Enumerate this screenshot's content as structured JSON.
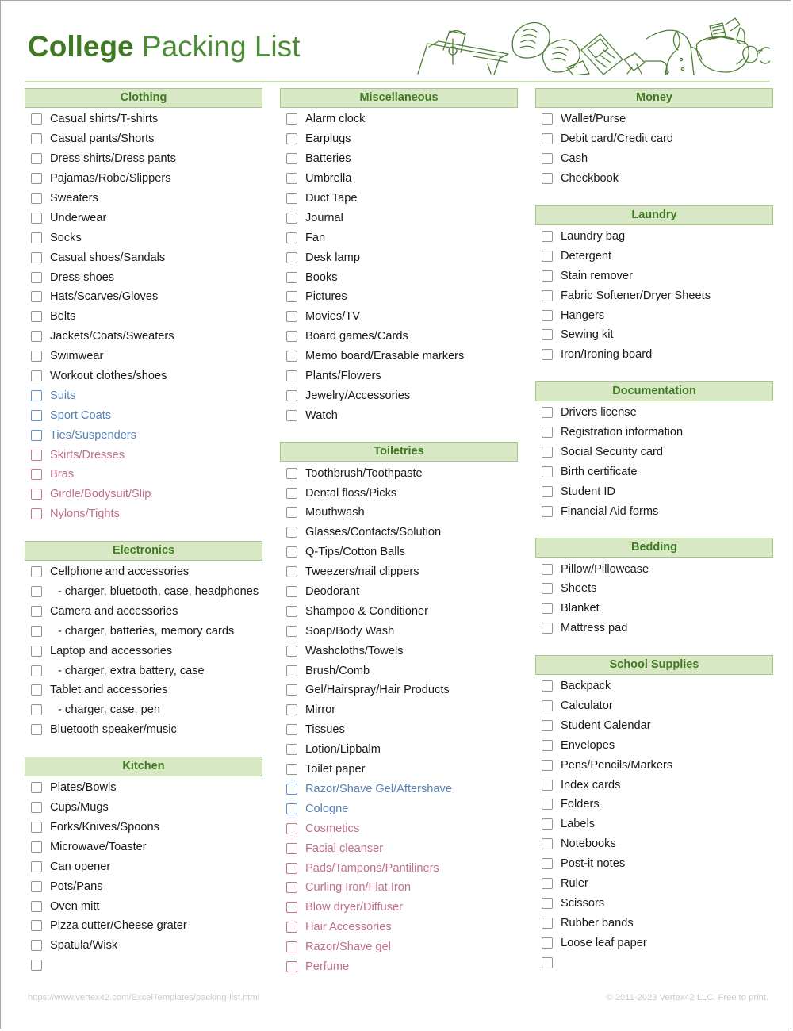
{
  "document": {
    "title_bold": "College",
    "title_light": "Packing List",
    "header_illustration": "travel-items-line-art"
  },
  "footer": {
    "url": "https://www.vertex42.com/ExcelTemplates/packing-list.html",
    "copyright": "© 2011-2023 Vertex42 LLC. Free to print."
  },
  "colors": {
    "header_fill": "#d9e8c4",
    "header_border": "#a5c888",
    "header_text": "#3f7a23",
    "title_green": "#4a8a2c",
    "rule": "#c3dfa8",
    "checkbox_default": "#8b9a8b",
    "male_accent": "#5b93d6",
    "male_text": "#5582b8",
    "female_accent": "#c4768f",
    "female_text": "#c06f8c",
    "footer_text": "#c9c9d4",
    "page_border": "#a6a6a6"
  },
  "columns": [
    {
      "name": "left",
      "sections": [
        {
          "title": "Clothing",
          "items": [
            {
              "label": "Casual shirts/T-shirts",
              "variant": "default"
            },
            {
              "label": "Casual pants/Shorts",
              "variant": "default"
            },
            {
              "label": "Dress shirts/Dress pants",
              "variant": "default"
            },
            {
              "label": "Pajamas/Robe/Slippers",
              "variant": "default"
            },
            {
              "label": "Sweaters",
              "variant": "default"
            },
            {
              "label": "Underwear",
              "variant": "default"
            },
            {
              "label": "Socks",
              "variant": "default"
            },
            {
              "label": "Casual shoes/Sandals",
              "variant": "default"
            },
            {
              "label": "Dress shoes",
              "variant": "default"
            },
            {
              "label": "Hats/Scarves/Gloves",
              "variant": "default"
            },
            {
              "label": "Belts",
              "variant": "default"
            },
            {
              "label": "Jackets/Coats/Sweaters",
              "variant": "default"
            },
            {
              "label": "Swimwear",
              "variant": "default"
            },
            {
              "label": "Workout clothes/shoes",
              "variant": "default"
            },
            {
              "label": "Suits",
              "variant": "male"
            },
            {
              "label": "Sport Coats",
              "variant": "male"
            },
            {
              "label": "Ties/Suspenders",
              "variant": "male"
            },
            {
              "label": "Skirts/Dresses",
              "variant": "female"
            },
            {
              "label": "Bras",
              "variant": "female"
            },
            {
              "label": "Girdle/Bodysuit/Slip",
              "variant": "female"
            },
            {
              "label": "Nylons/Tights",
              "variant": "female"
            }
          ]
        },
        {
          "title": "Electronics",
          "items": [
            {
              "label": "Cellphone and accessories",
              "variant": "default"
            },
            {
              "label": "- charger, bluetooth, case, headphones",
              "variant": "sub"
            },
            {
              "label": "Camera and accessories",
              "variant": "default"
            },
            {
              "label": "- charger, batteries, memory cards",
              "variant": "sub"
            },
            {
              "label": "Laptop and accessories",
              "variant": "default"
            },
            {
              "label": "- charger, extra battery, case",
              "variant": "sub"
            },
            {
              "label": "Tablet and accessories",
              "variant": "default"
            },
            {
              "label": "- charger, case, pen",
              "variant": "sub"
            },
            {
              "label": "Bluetooth speaker/music",
              "variant": "default"
            }
          ]
        },
        {
          "title": "Kitchen",
          "items": [
            {
              "label": "Plates/Bowls",
              "variant": "default"
            },
            {
              "label": "Cups/Mugs",
              "variant": "default"
            },
            {
              "label": "Forks/Knives/Spoons",
              "variant": "default"
            },
            {
              "label": "Microwave/Toaster",
              "variant": "default"
            },
            {
              "label": "Can opener",
              "variant": "default"
            },
            {
              "label": "Pots/Pans",
              "variant": "default"
            },
            {
              "label": "Oven mitt",
              "variant": "default"
            },
            {
              "label": "Pizza cutter/Cheese grater",
              "variant": "default"
            },
            {
              "label": "Spatula/Wisk",
              "variant": "default"
            },
            {
              "label": " ",
              "variant": "blank"
            }
          ]
        }
      ]
    },
    {
      "name": "middle",
      "sections": [
        {
          "title": "Miscellaneous",
          "items": [
            {
              "label": "Alarm clock",
              "variant": "default"
            },
            {
              "label": "Earplugs",
              "variant": "default"
            },
            {
              "label": "Batteries",
              "variant": "default"
            },
            {
              "label": "Umbrella",
              "variant": "default"
            },
            {
              "label": "Duct Tape",
              "variant": "default"
            },
            {
              "label": "Journal",
              "variant": "default"
            },
            {
              "label": "Fan",
              "variant": "default"
            },
            {
              "label": "Desk lamp",
              "variant": "default"
            },
            {
              "label": "Books",
              "variant": "default"
            },
            {
              "label": "Pictures",
              "variant": "default"
            },
            {
              "label": "Movies/TV",
              "variant": "default"
            },
            {
              "label": "Board games/Cards",
              "variant": "default"
            },
            {
              "label": "Memo board/Erasable markers",
              "variant": "default"
            },
            {
              "label": "Plants/Flowers",
              "variant": "default"
            },
            {
              "label": "Jewelry/Accessories",
              "variant": "default"
            },
            {
              "label": "Watch",
              "variant": "default"
            }
          ]
        },
        {
          "title": "Toiletries",
          "items": [
            {
              "label": "Toothbrush/Toothpaste",
              "variant": "default"
            },
            {
              "label": "Dental floss/Picks",
              "variant": "default"
            },
            {
              "label": "Mouthwash",
              "variant": "default"
            },
            {
              "label": "Glasses/Contacts/Solution",
              "variant": "default"
            },
            {
              "label": "Q-Tips/Cotton Balls",
              "variant": "default"
            },
            {
              "label": "Tweezers/nail clippers",
              "variant": "default"
            },
            {
              "label": "Deodorant",
              "variant": "default"
            },
            {
              "label": "Shampoo & Conditioner",
              "variant": "default"
            },
            {
              "label": "Soap/Body Wash",
              "variant": "default"
            },
            {
              "label": "Washcloths/Towels",
              "variant": "default"
            },
            {
              "label": "Brush/Comb",
              "variant": "default"
            },
            {
              "label": "Gel/Hairspray/Hair Products",
              "variant": "default"
            },
            {
              "label": "Mirror",
              "variant": "default"
            },
            {
              "label": "Tissues",
              "variant": "default"
            },
            {
              "label": "Lotion/Lipbalm",
              "variant": "default"
            },
            {
              "label": "Toilet paper",
              "variant": "default"
            },
            {
              "label": "Razor/Shave Gel/Aftershave",
              "variant": "male"
            },
            {
              "label": "Cologne",
              "variant": "male"
            },
            {
              "label": "Cosmetics",
              "variant": "female"
            },
            {
              "label": "Facial cleanser",
              "variant": "female"
            },
            {
              "label": "Pads/Tampons/Pantiliners",
              "variant": "female"
            },
            {
              "label": "Curling Iron/Flat Iron",
              "variant": "female"
            },
            {
              "label": "Blow dryer/Diffuser",
              "variant": "female"
            },
            {
              "label": "Hair Accessories",
              "variant": "female"
            },
            {
              "label": "Razor/Shave gel",
              "variant": "female"
            },
            {
              "label": "Perfume",
              "variant": "female"
            }
          ]
        }
      ]
    },
    {
      "name": "right",
      "sections": [
        {
          "title": "Money",
          "items": [
            {
              "label": "Wallet/Purse",
              "variant": "default"
            },
            {
              "label": "Debit card/Credit card",
              "variant": "default"
            },
            {
              "label": "Cash",
              "variant": "default"
            },
            {
              "label": "Checkbook",
              "variant": "default"
            }
          ]
        },
        {
          "title": "Laundry",
          "items": [
            {
              "label": "Laundry bag",
              "variant": "default"
            },
            {
              "label": "Detergent",
              "variant": "default"
            },
            {
              "label": "Stain remover",
              "variant": "default"
            },
            {
              "label": "Fabric Softener/Dryer Sheets",
              "variant": "default"
            },
            {
              "label": "Hangers",
              "variant": "default"
            },
            {
              "label": "Sewing kit",
              "variant": "default"
            },
            {
              "label": "Iron/Ironing board",
              "variant": "default"
            }
          ]
        },
        {
          "title": "Documentation",
          "items": [
            {
              "label": "Drivers license",
              "variant": "default"
            },
            {
              "label": "Registration information",
              "variant": "default"
            },
            {
              "label": "Social Security card",
              "variant": "default"
            },
            {
              "label": "Birth certificate",
              "variant": "default"
            },
            {
              "label": "Student ID",
              "variant": "default"
            },
            {
              "label": "Financial Aid forms",
              "variant": "default"
            }
          ]
        },
        {
          "title": "Bedding",
          "items": [
            {
              "label": "Pillow/Pillowcase",
              "variant": "default"
            },
            {
              "label": "Sheets",
              "variant": "default"
            },
            {
              "label": "Blanket",
              "variant": "default"
            },
            {
              "label": "Mattress pad",
              "variant": "default"
            }
          ]
        },
        {
          "title": "School Supplies",
          "items": [
            {
              "label": "Backpack",
              "variant": "default"
            },
            {
              "label": "Calculator",
              "variant": "default"
            },
            {
              "label": "Student Calendar",
              "variant": "default"
            },
            {
              "label": "Envelopes",
              "variant": "default"
            },
            {
              "label": "Pens/Pencils/Markers",
              "variant": "default"
            },
            {
              "label": "Index cards",
              "variant": "default"
            },
            {
              "label": "Folders",
              "variant": "default"
            },
            {
              "label": "Labels",
              "variant": "default"
            },
            {
              "label": "Notebooks",
              "variant": "default"
            },
            {
              "label": "Post-it notes",
              "variant": "default"
            },
            {
              "label": "Ruler",
              "variant": "default"
            },
            {
              "label": "Scissors",
              "variant": "default"
            },
            {
              "label": "Rubber bands",
              "variant": "default"
            },
            {
              "label": "Loose leaf paper",
              "variant": "default"
            },
            {
              "label": " ",
              "variant": "blank"
            }
          ]
        }
      ]
    }
  ]
}
